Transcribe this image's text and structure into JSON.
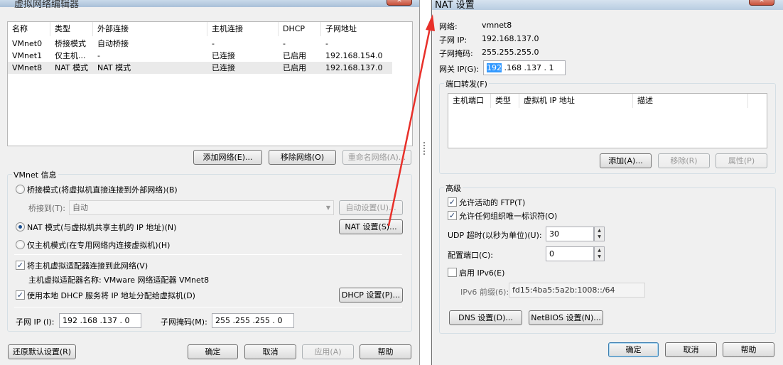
{
  "left": {
    "title": "虚拟网络编辑器",
    "table": {
      "headers": [
        "名称",
        "类型",
        "外部连接",
        "主机连接",
        "DHCP",
        "子网地址"
      ],
      "rows": [
        [
          "VMnet0",
          "桥接模式",
          "自动桥接",
          "-",
          "-",
          "-"
        ],
        [
          "VMnet1",
          "仅主机...",
          "-",
          "已连接",
          "已启用",
          "192.168.154.0"
        ],
        [
          "VMnet8",
          "NAT 模式",
          "NAT 模式",
          "已连接",
          "已启用",
          "192.168.137.0"
        ]
      ]
    },
    "add_network": "添加网络(E)...",
    "remove_network": "移除网络(O)",
    "rename_network": "重命名网络(A)...",
    "vmnet_info": "VMnet 信息",
    "bridge_radio": "桥接模式(将虚拟机直接连接到外部网络)(B)",
    "bridge_to_label": "桥接到(T):",
    "bridge_to_value": "自动",
    "auto_settings": "自动设置(U)...",
    "nat_radio": "NAT 模式(与虚拟机共享主机的 IP 地址)(N)",
    "nat_settings": "NAT 设置(S)...",
    "hostonly_radio": "仅主机模式(在专用网络内连接虚拟机)(H)",
    "connect_adapter": "将主机虚拟适配器连接到此网络(V)",
    "adapter_name": "主机虚拟适配器名称: VMware 网络适配器 VMnet8",
    "use_dhcp": "使用本地 DHCP 服务将 IP 地址分配给虚拟机(D)",
    "dhcp_settings": "DHCP 设置(P)...",
    "subnet_ip_label": "子网 IP (I):",
    "subnet_ip": "192 .168 .137 . 0",
    "subnet_mask_label": "子网掩码(M):",
    "subnet_mask": "255 .255 .255 . 0",
    "restore_defaults": "还原默认设置(R)",
    "ok": "确定",
    "cancel": "取消",
    "apply": "应用(A)",
    "help": "帮助"
  },
  "right": {
    "title": "NAT 设置",
    "network_label": "网络:",
    "network_value": "vmnet8",
    "subnet_ip_label": "子网 IP:",
    "subnet_ip_value": "192.168.137.0",
    "subnet_mask_label": "子网掩码:",
    "subnet_mask_value": "255.255.255.0",
    "gateway_label": "网关 IP(G):",
    "gateway_sel": "192",
    "gateway_rest": " .168 .137 . 1",
    "port_forward": "端口转发(F)",
    "pf_headers": [
      "主机端口",
      "类型",
      "虚拟机 IP 地址",
      "描述"
    ],
    "add": "添加(A)...",
    "remove": "移除(R)",
    "properties": "属性(P)",
    "advanced": "高级",
    "allow_ftp": "允许活动的 FTP(T)",
    "allow_oui": "允许任何组织唯一标识符(O)",
    "udp_timeout_label": "UDP 超时(以秒为单位)(U):",
    "udp_timeout": "30",
    "config_port_label": "配置端口(C):",
    "config_port": "0",
    "enable_ipv6": "启用 IPv6(E)",
    "ipv6_prefix_label": "IPv6 前缀(6):",
    "ipv6_prefix": "fd15:4ba5:5a2b:1008::/64",
    "dns_settings": "DNS 设置(D)...",
    "netbios_settings": "NetBIOS 设置(N)...",
    "ok": "确定",
    "cancel": "取消",
    "help": "帮助"
  },
  "colors": {
    "arrow": "#e8302a",
    "selection": "#3399ff"
  },
  "icons": [
    "close-icon",
    "grip-icon"
  ]
}
